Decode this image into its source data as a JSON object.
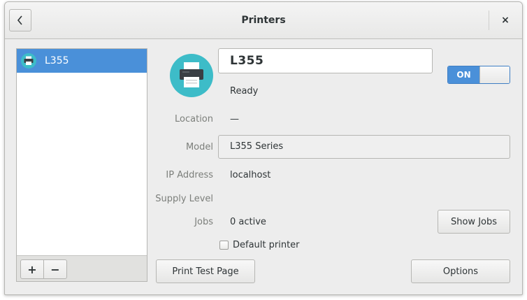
{
  "window": {
    "title": "Printers"
  },
  "headerbar": {
    "back_icon": "chevron-left-icon",
    "close_label": "×"
  },
  "sidebar": {
    "printers": [
      {
        "name": "L355",
        "icon": "printer-icon",
        "selected": true
      }
    ],
    "add_label": "+",
    "remove_label": "−"
  },
  "details": {
    "name": "L355",
    "status": "Ready",
    "enabled": {
      "label": "ON",
      "state": true
    },
    "location": {
      "label": "Location",
      "value": "—"
    },
    "model": {
      "label": "Model",
      "value": "L355 Series"
    },
    "ip_address": {
      "label": "IP Address",
      "value": "localhost"
    },
    "supply_level": {
      "label": "Supply Level"
    },
    "jobs": {
      "label": "Jobs",
      "value": "0 active",
      "button": "Show Jobs"
    },
    "default_printer": {
      "label": "Default printer",
      "checked": false
    },
    "print_test_page": "Print Test Page",
    "options": "Options"
  },
  "colors": {
    "accent": "#4a90d9",
    "icon_circle": "#3dbcc8"
  }
}
